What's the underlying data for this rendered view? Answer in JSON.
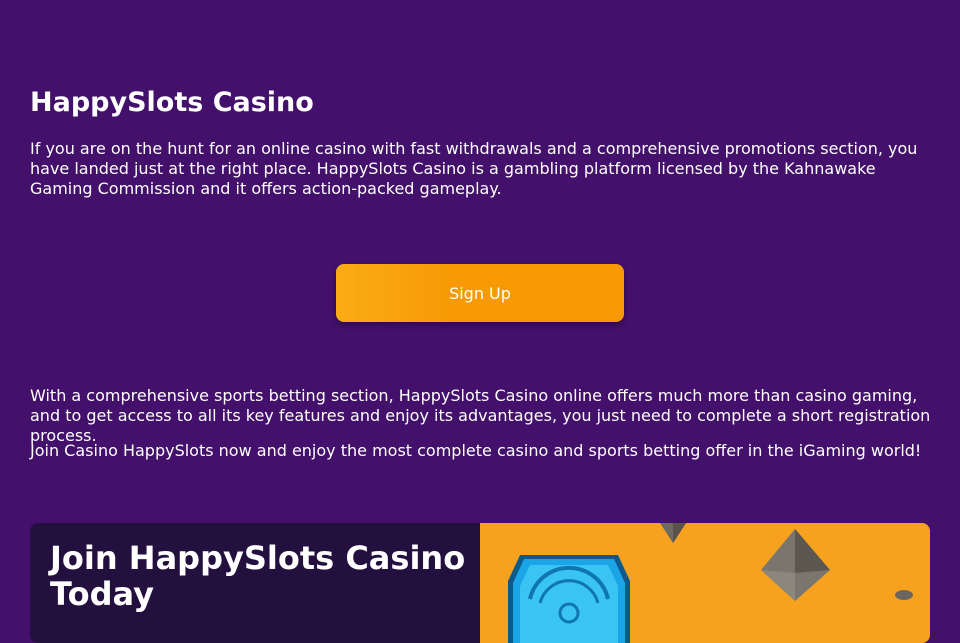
{
  "header": {
    "title": "HappySlots Casino"
  },
  "intro": {
    "text": "If you are on the hunt for an online casino with fast withdrawals and a comprehensive promotions section, you have landed just at the right place. HappySlots Casino is a gambling platform licensed by the Kahnawake Gaming Commission and it offers action-packed gameplay."
  },
  "cta": {
    "signup_label": "Sign Up"
  },
  "body": {
    "paragraph_2": "With a comprehensive sports betting section, HappySlots Casino online offers much more than casino gaming, and to get access to all its key features and enjoy its advantages, you just need to complete a short registration process.",
    "paragraph_3": "Join Casino HappySlots now and enjoy the most complete casino and sports betting offer in the iGaming world!"
  },
  "promo": {
    "title": "Join HappySlots Casino Today"
  },
  "colors": {
    "background": "#43106b",
    "button": "#f79a06",
    "promo_dark": "#24103f",
    "promo_orange": "#f6a21e"
  }
}
